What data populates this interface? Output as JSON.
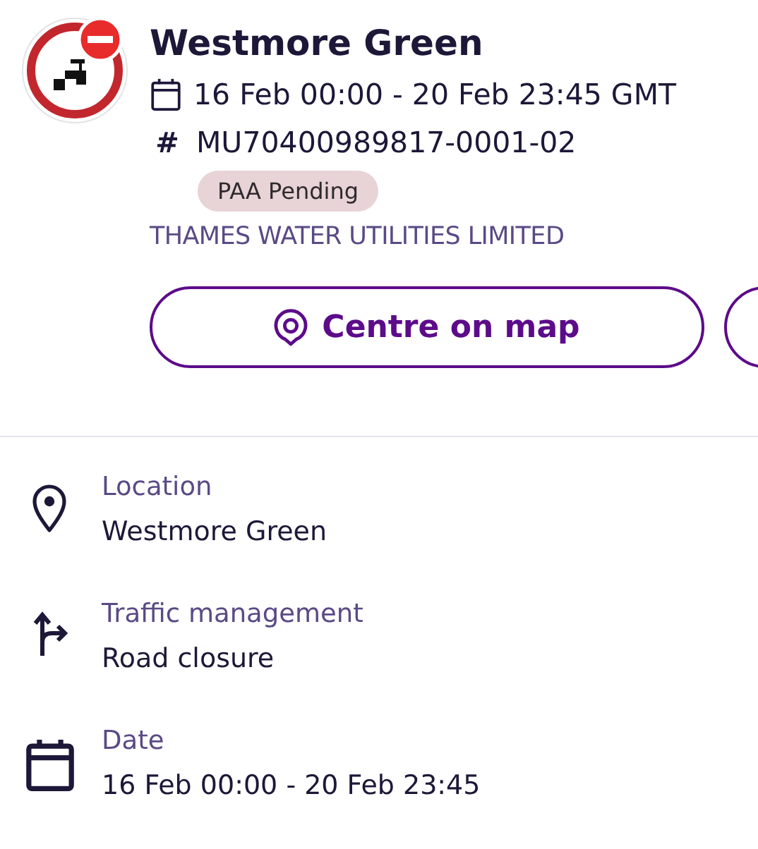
{
  "header": {
    "title": "Westmore Green",
    "dates": "16 Feb 00:00 - 20 Feb 23:45 GMT",
    "hash_icon": "#",
    "reference": "MU70400989817-0001-02",
    "status_badge": "PAA Pending",
    "organisation": "THAMES WATER UTILITIES LIMITED"
  },
  "actions": [
    {
      "label": "Centre on map",
      "kind": "map"
    },
    {
      "kind": "cut"
    }
  ],
  "details": [
    {
      "kind": "location",
      "label": "Location",
      "value": "Westmore Green"
    },
    {
      "kind": "traffic",
      "label": "Traffic management",
      "value": "Road closure"
    },
    {
      "kind": "date",
      "label": "Date",
      "value": "16 Feb 00:00 - 20 Feb 23:45"
    }
  ]
}
